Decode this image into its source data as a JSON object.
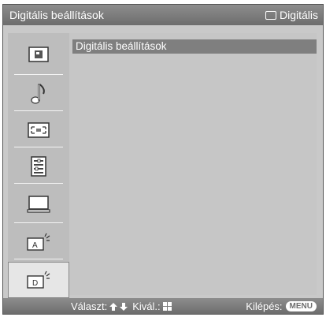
{
  "header": {
    "title": "Digitális beállítások",
    "mode_icon": "rectangle-icon",
    "mode_label": "Digitális"
  },
  "sidebar": {
    "items": [
      {
        "name": "picture-icon"
      },
      {
        "name": "sound-icon"
      },
      {
        "name": "screen-icon"
      },
      {
        "name": "setup-list-icon"
      },
      {
        "name": "pc-monitor-icon"
      },
      {
        "name": "analog-settings-icon",
        "letter": "A"
      },
      {
        "name": "digital-settings-icon",
        "letter": "D",
        "selected": true
      }
    ]
  },
  "content": {
    "items": [
      {
        "label": "Digitális beállítások"
      }
    ]
  },
  "footer": {
    "select_label": "Választ:",
    "enter_label": "Kivál.:",
    "exit_label": "Kilépés:",
    "menu_key": "MENU"
  },
  "colors": {
    "header_bg": "#7a7a7a",
    "content_bg": "#c6c6c6",
    "highlight": "#7f7f7f"
  }
}
